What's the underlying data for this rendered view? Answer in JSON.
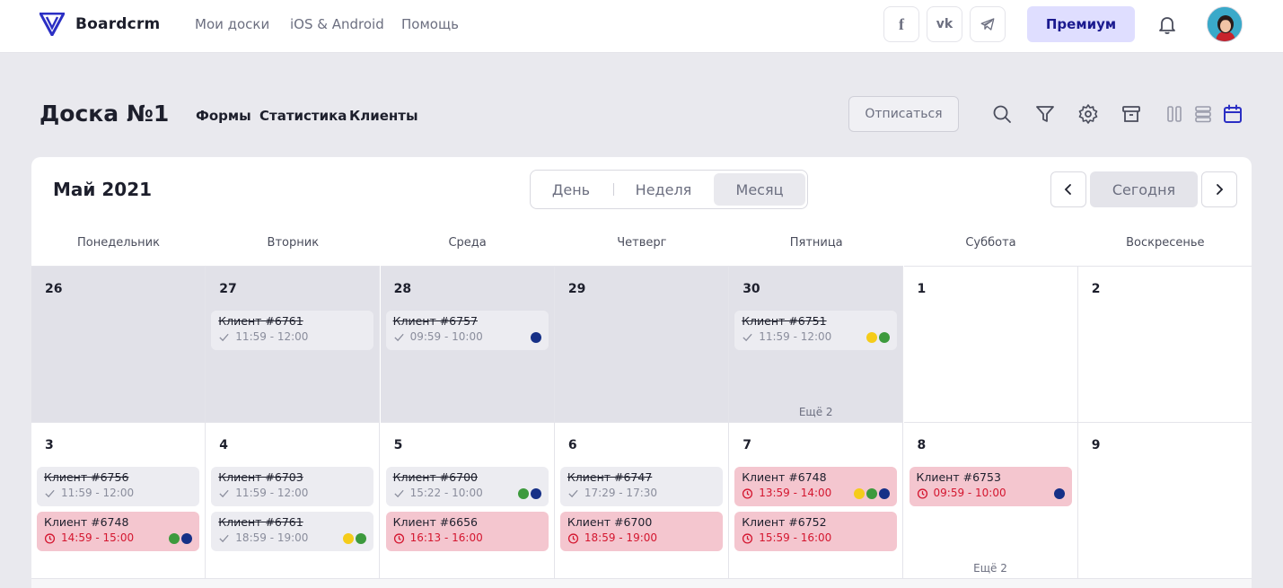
{
  "app": {
    "name": "Boardcrm"
  },
  "nav": {
    "links": [
      "Мои доски",
      "iOS & Android",
      "Помощь"
    ]
  },
  "social": {
    "facebook": "f",
    "vk": "vk",
    "telegram": "telegram"
  },
  "premium_label": "Премиум",
  "board": {
    "title": "Доска №1",
    "links": [
      "Формы",
      "Статистика",
      "Клиенты"
    ],
    "unsubscribe_label": "Отписаться"
  },
  "calendar": {
    "month_title": "Май 2021",
    "views": [
      "День",
      "Неделя",
      "Месяц"
    ],
    "active_view": "Месяц",
    "today_label": "Сегодня",
    "weekdays": [
      "Понедельник",
      "Вторник",
      "Среда",
      "Четверг",
      "Пятница",
      "Суббота",
      "Воскресенье"
    ],
    "more_label": "Ещё 2",
    "colors": {
      "yellow": "#f5cc1a",
      "green": "#3d9a3d",
      "navy": "#163087",
      "late_text": "#d4162f",
      "late_bg": "#f4c6cf"
    },
    "weeks": [
      [
        {
          "day": "26",
          "past": true,
          "events": []
        },
        {
          "day": "27",
          "past": true,
          "events": [
            {
              "name": "Клиент #6761",
              "time": "11:59 - 12:00",
              "status": "done",
              "dots": []
            }
          ]
        },
        {
          "day": "28",
          "past": true,
          "events": [
            {
              "name": "Клиент #6757",
              "time": "09:59 - 10:00",
              "status": "done",
              "dots": [
                "navy"
              ]
            }
          ]
        },
        {
          "day": "29",
          "past": true,
          "events": []
        },
        {
          "day": "30",
          "past": true,
          "more": true,
          "events": [
            {
              "name": "Клиент #6751",
              "time": "11:59 - 12:00",
              "status": "done",
              "dots": [
                "yellow",
                "green"
              ]
            }
          ]
        },
        {
          "day": "1",
          "past": false,
          "events": []
        },
        {
          "day": "2",
          "past": false,
          "events": []
        }
      ],
      [
        {
          "day": "3",
          "past": false,
          "events": [
            {
              "name": "Клиент #6756",
              "time": "11:59 - 12:00",
              "status": "done",
              "dots": []
            },
            {
              "name": "Клиент #6748",
              "time": "14:59 - 15:00",
              "status": "late",
              "dots": [
                "green",
                "navy"
              ]
            }
          ]
        },
        {
          "day": "4",
          "past": false,
          "events": [
            {
              "name": "Клиент #6703",
              "time": "11:59 - 12:00",
              "status": "done",
              "dots": []
            },
            {
              "name": "Клиент #6761",
              "time": "18:59 - 19:00",
              "status": "done",
              "dots": [
                "yellow",
                "green"
              ]
            }
          ]
        },
        {
          "day": "5",
          "past": false,
          "events": [
            {
              "name": "Клиент #6700",
              "time": "15:22 - 10:00",
              "status": "done",
              "dots": [
                "green",
                "navy"
              ]
            },
            {
              "name": "Клиент #6656",
              "time": "16:13 - 16:00",
              "status": "late",
              "dots": []
            }
          ]
        },
        {
          "day": "6",
          "past": false,
          "events": [
            {
              "name": "Клиент #6747",
              "time": "17:29 - 17:30",
              "status": "done",
              "dots": []
            },
            {
              "name": "Клиент #6700",
              "time": "18:59 - 19:00",
              "status": "late",
              "dots": []
            }
          ]
        },
        {
          "day": "7",
          "past": false,
          "events": [
            {
              "name": "Клиент #6748",
              "time": "13:59 - 14:00",
              "status": "late",
              "dots": [
                "yellow",
                "green",
                "navy"
              ]
            },
            {
              "name": "Клиент #6752",
              "time": "15:59 - 16:00",
              "status": "late",
              "dots": []
            }
          ]
        },
        {
          "day": "8",
          "past": false,
          "more": true,
          "events": [
            {
              "name": "Клиент #6753",
              "time": "09:59 - 10:00",
              "status": "late",
              "dots": [
                "navy"
              ]
            }
          ]
        },
        {
          "day": "9",
          "past": false,
          "events": []
        }
      ]
    ]
  }
}
